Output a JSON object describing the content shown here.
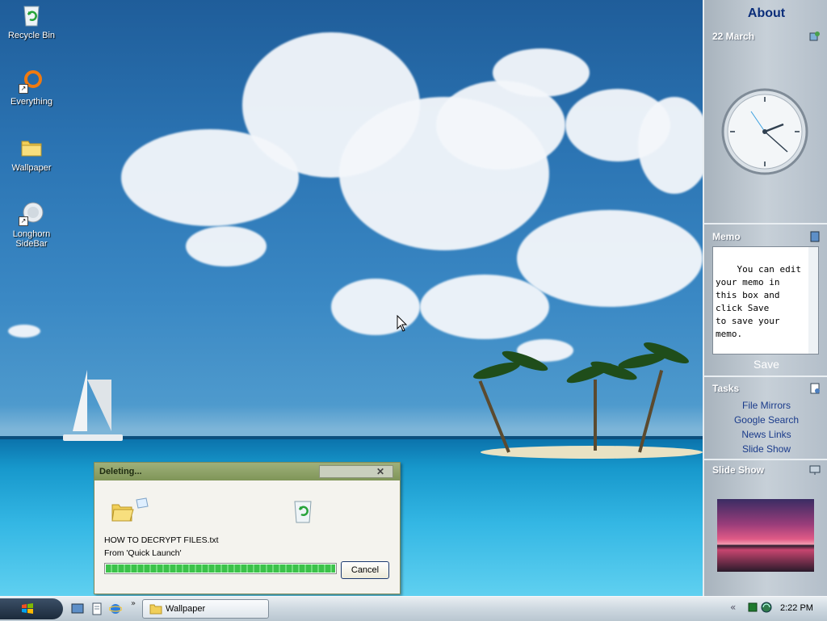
{
  "desktop": {
    "icons": [
      {
        "label": "Recycle Bin"
      },
      {
        "label": "Everything"
      },
      {
        "label": "Wallpaper"
      },
      {
        "label": "Longhorn SideBar"
      }
    ]
  },
  "dialog": {
    "title": "Deleting...",
    "close_glyph": "✕",
    "file_name": "HOW TO DECRYPT FILES.txt",
    "source": "From 'Quick Launch'",
    "progress_fraction": 1.0,
    "cancel_label": "Cancel"
  },
  "sidebar": {
    "about_label": "About",
    "date": "22 March",
    "memo": {
      "title": "Memo",
      "text": "You can edit\nyour memo in\nthis box and\nclick Save\nto save your\nmemo.",
      "save_label": "Save"
    },
    "tasks": {
      "title": "Tasks",
      "items": [
        "File Mirrors",
        "Google Search",
        "News Links",
        "Slide Show"
      ]
    },
    "slideshow": {
      "title": "Slide Show"
    }
  },
  "taskbar": {
    "more_glyph": "»",
    "window_button_label": "Wallpaper",
    "time": "2:22 PM"
  },
  "icons_used": [
    "recycle-bin-icon",
    "everything-icon",
    "folder-icon",
    "longhorn-sidebar-icon",
    "windows-orb-icon",
    "clock-icon",
    "memo-icon",
    "tasks-icon",
    "slideshow-icon"
  ]
}
